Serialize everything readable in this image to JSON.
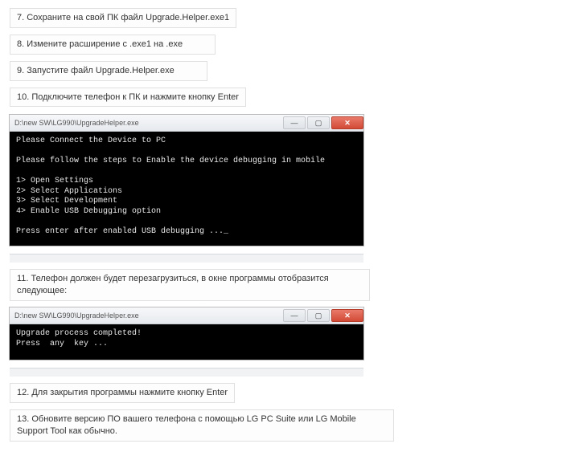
{
  "steps": {
    "s7": "7. Сохраните на свой ПК файл Upgrade.Helper.exe1",
    "s8": "8. Измените расширение с .exe1 на .exe",
    "s9": "9. Запустите файл Upgrade.Helper.exe",
    "s10": "10. Подключите телефон к ПК и нажмите кнопку Enter",
    "s11": "11. Телефон должен будет перезагрузиться, в окне программы отобразится следующее:",
    "s12": "12. Для закрытия программы нажмите кнопку Enter",
    "s13": "13. Обновите версию ПО вашего телефона с помощью LG PC Suite или LG Mobile Support Tool как обычно."
  },
  "win1": {
    "title": "D:\\new SW\\LG990\\UpgradeHelper.exe",
    "body": "Please Connect the Device to PC\n\nPlease follow the steps to Enable the device debugging in mobile\n\n1> Open Settings\n2> Select Applications\n3> Select Development\n4> Enable USB Debugging option\n\nPress enter after enabled USB debugging ..._"
  },
  "win2": {
    "title": "D:\\new SW\\LG990\\UpgradeHelper.exe",
    "body": "Upgrade process completed!\nPress  any  key ..."
  },
  "btn": {
    "min": "—",
    "max": "▢",
    "close": "✕"
  }
}
